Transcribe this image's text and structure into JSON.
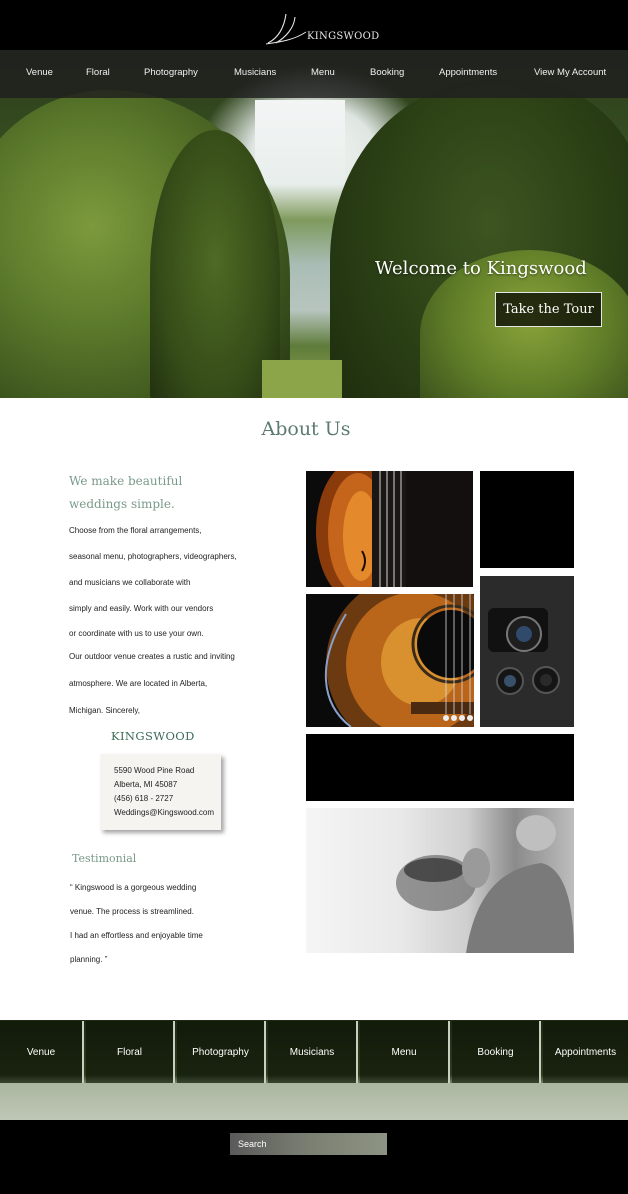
{
  "header": {
    "brand": "KINGSWOOD"
  },
  "nav": {
    "items": [
      "Venue",
      "Floral",
      "Photography",
      "Musicians",
      "Menu",
      "Booking",
      "Appointments",
      "View My Account"
    ]
  },
  "hero": {
    "headline": "Welcome to Kingswood",
    "cta_label": "Take the Tour"
  },
  "about": {
    "title": "About Us",
    "tagline_line1": "We make beautiful",
    "tagline_line2": "weddings simple.",
    "paragraph_lines": [
      "Choose from the floral arrangements,",
      "seasonal menu, photographers, videographers,",
      "and musicians we collaborate with",
      "simply and easily. Work with our vendors",
      "or coordinate with us to use your own.",
      "Our outdoor venue creates a rustic and inviting",
      "atmosphere. We are located in Alberta,",
      "Michigan. Sincerely,"
    ],
    "signature": "KINGSWOOD"
  },
  "contact": {
    "street": "5590 Wood Pine Road",
    "city": "Alberta, MI 45087",
    "phone": "(456) 618 - 2727",
    "email": "Weddings@Kingswood.com"
  },
  "testimonial": {
    "title": "Testimonial",
    "lines": [
      "“  Kingswood is a  gorgeous wedding",
      "venue. The process is streamlined.",
      "I had an effortless and enjoyable time",
      "planning. ”"
    ]
  },
  "bottom_nav": {
    "items": [
      "Venue",
      "Floral",
      "Photography",
      "Musicians",
      "Menu",
      "Booking",
      "Appointments"
    ]
  },
  "footer": {
    "search_placeholder": "Search"
  }
}
